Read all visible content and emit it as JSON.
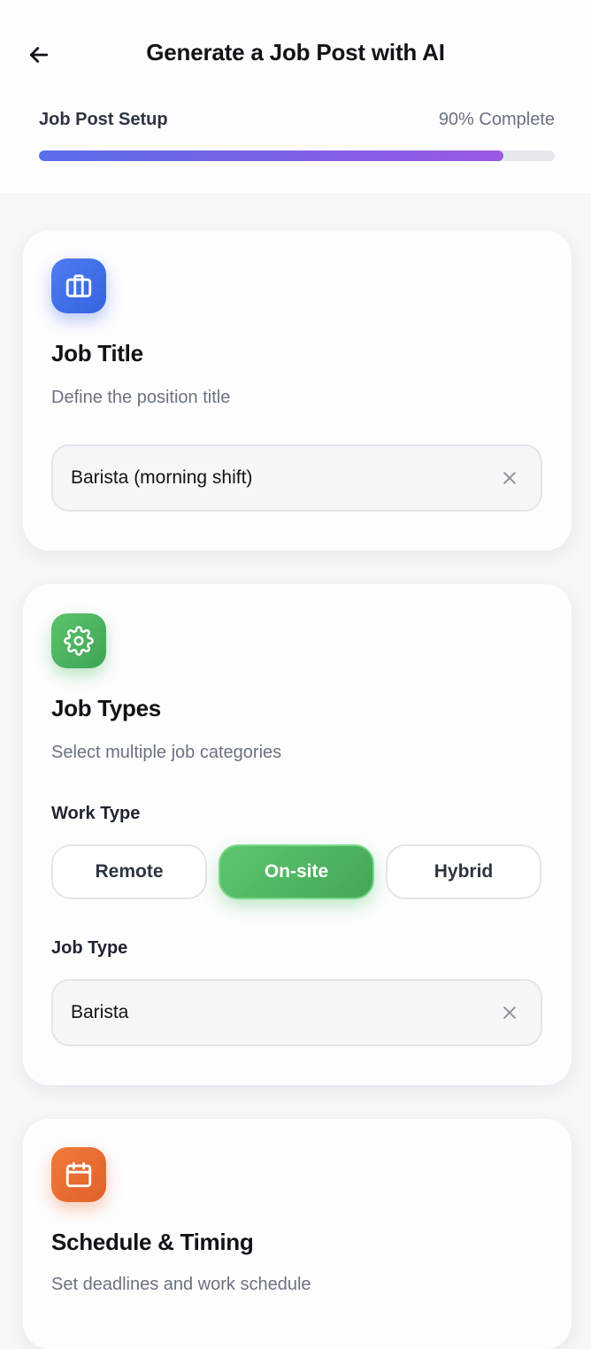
{
  "header": {
    "title": "Generate a Job Post with AI",
    "back_icon": "arrow-left-icon"
  },
  "progress": {
    "label": "Job Post Setup",
    "percent_text": "90% Complete",
    "value": 0.9,
    "gradient": [
      "#5b6ee8",
      "#9b59e4"
    ]
  },
  "job_title_card": {
    "icon": "briefcase-icon",
    "icon_color": "#3f6fe6",
    "title": "Job Title",
    "subtitle": "Define the position title",
    "input_value": "Barista (morning shift)",
    "clear_icon": "close-icon"
  },
  "job_types_card": {
    "icon": "gear-icon",
    "icon_color": "#4cb560",
    "title": "Job Types",
    "subtitle": "Select multiple job categories",
    "work_type_label": "Work Type",
    "work_type_options": [
      "Remote",
      "On-site",
      "Hybrid"
    ],
    "work_type_selected": "On-site",
    "job_type_label": "Job Type",
    "job_type_value": "Barista",
    "clear_icon": "close-icon"
  },
  "schedule_card": {
    "icon": "calendar-icon",
    "icon_color": "#e86c32",
    "title": "Schedule & Timing",
    "subtitle": "Set deadlines and work schedule"
  }
}
